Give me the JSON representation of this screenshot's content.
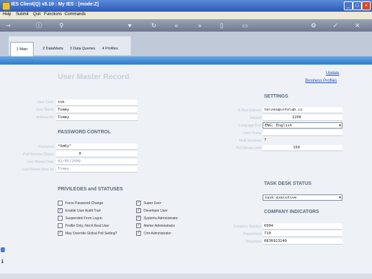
{
  "window": {
    "title": "IES Client(Q) v8.19 : My IES :      [mode:Z]"
  },
  "menu": [
    "Help",
    "Submit",
    "Quit",
    "Functions",
    "Commands"
  ],
  "toolbar_icons": [
    "key-icon",
    "info-icon",
    "search-icon",
    "heart-icon",
    "refresh-icon",
    "rewind-icon",
    "fast-forward-icon",
    "document-icon",
    "trash-icon",
    "settings-icon",
    "check-icon",
    "close-icon"
  ],
  "tabs": [
    "1 Main",
    "2 DataMarts",
    "3 Data Queries",
    "4 Profiles"
  ],
  "page": {
    "title": "User Master Record"
  },
  "links": {
    "update": "Update",
    "business_profiles": "Business Profiles"
  },
  "user": {
    "user_code_label": "User Code",
    "user_code": "tok",
    "user_name_label": "User Name",
    "user_name": "Tommy",
    "address_as_label": "Address As",
    "address_as": "Tommy"
  },
  "password": {
    "heading": "PASSWORD CONTROL",
    "password_label": "Password",
    "password": "*Xm6y^",
    "poll_recover_label": "Poll Recover (Days)",
    "poll_recover": "0",
    "last_renew_label": "Last Renew Date",
    "last_renew": "02/05/2009",
    "last_renew_by_label": "Last Renew done by",
    "last_renew_by": "Tommy"
  },
  "privileges": {
    "heading": "PRIVILEGES and STATUSES",
    "left": [
      {
        "label": "Force Password Change",
        "checked": false
      },
      {
        "label": "Enable User Audit Trail",
        "checked": true
      },
      {
        "label": "Suspended From Logon",
        "checked": false
      },
      {
        "label": "Profile Only, Not A Real User",
        "checked": false
      },
      {
        "label": "May Override Global Poll Setting?",
        "checked": true
      }
    ],
    "right": [
      {
        "label": "Super User",
        "checked": true
      },
      {
        "label": "Developer User",
        "checked": true
      },
      {
        "label": "Systems Administrator",
        "checked": true
      },
      {
        "label": "Alerter Administrator",
        "checked": true
      },
      {
        "label": "Crm Administrator",
        "checked": true
      }
    ]
  },
  "settings": {
    "heading": "SETTINGS",
    "email_label": "E-Mail Address",
    "email": "terzen@infolab.cc",
    "internal_label": "Internal",
    "internal": "1200",
    "language_label": "Language Pref",
    "language": "ENG: English",
    "user_group_label": "User Group",
    "user_group": "",
    "multi_sessions_label": "Multi Sessions",
    "multi_sessions": "?",
    "poll_minute_label": "Poll Minute Limit",
    "poll_minute": "150"
  },
  "task_desk": {
    "heading": "TASK DESK STATUS",
    "value": "task executive"
  },
  "company": {
    "heading": "COMPANY INDICATORS",
    "number_label": "Company Number",
    "number": "6904",
    "department_label": "Department",
    "department": "710",
    "telephone_label": "Telephone",
    "telephone": "0836923140"
  }
}
